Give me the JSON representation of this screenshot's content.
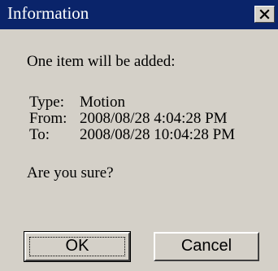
{
  "window": {
    "title": "Information"
  },
  "message": {
    "intro": "One item will be added:",
    "type_label": "Type:",
    "type_value": "Motion",
    "from_label": "From:",
    "from_value": "2008/08/28 4:04:28 PM",
    "to_label": "To:",
    "to_value": "2008/08/28 10:04:28 PM",
    "question": "Are you sure?"
  },
  "buttons": {
    "ok_label": "OK",
    "cancel_label": "Cancel"
  },
  "colors": {
    "titlebar": "#0a246a",
    "face": "#d4d0c8"
  },
  "icons": {
    "close": "close-icon"
  }
}
